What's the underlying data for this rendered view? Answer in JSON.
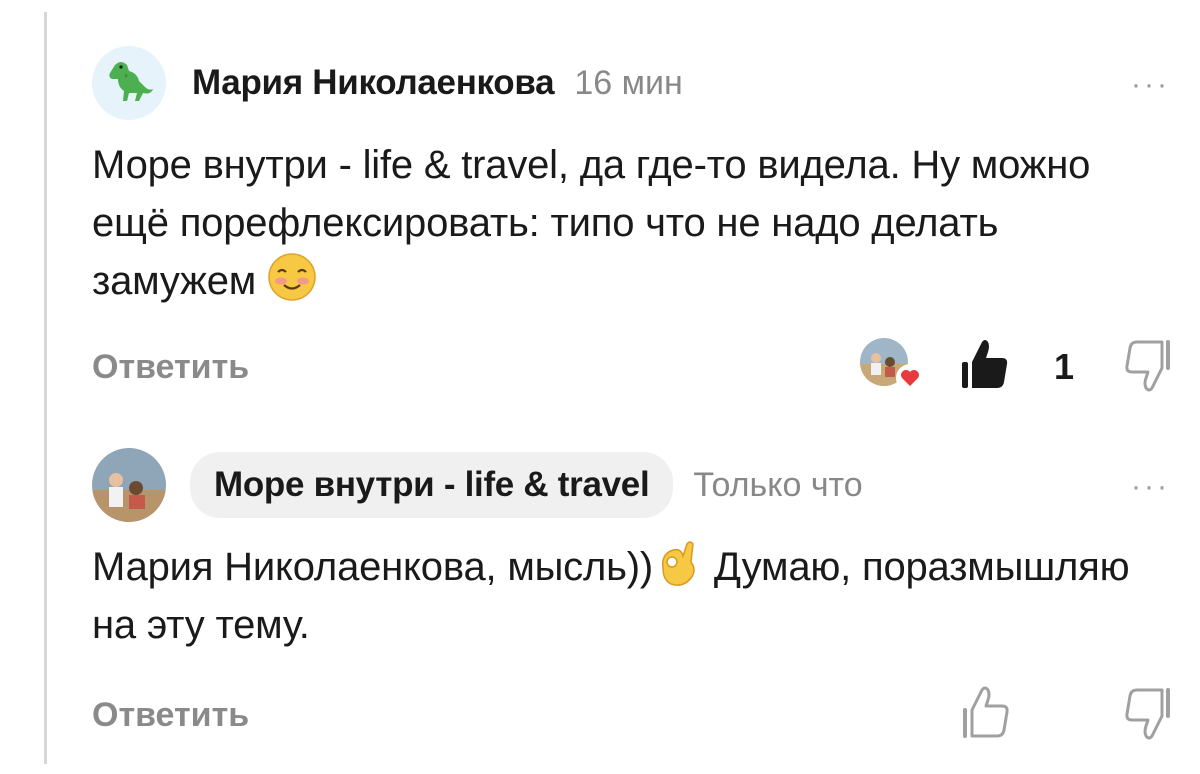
{
  "comments": [
    {
      "author": "Мария Николаенкова",
      "time": "16 мин",
      "text": "Море внутри - life & travel, да где-то видела. Ну можно ещё порефлексировать: типо что не надо делать замужем",
      "emoji": "smiling-blush-emoji",
      "reply_label": "Ответить",
      "like_count": "1",
      "liked": true,
      "more_label": "···"
    },
    {
      "author": "Море внутри - life & travel",
      "time": "Только что",
      "text_before": "Мария Николаенкова, мысль))",
      "emoji": "ok-hand-emoji",
      "text_after": " Думаю, поразмышляю на эту тему.",
      "reply_label": "Ответить",
      "liked": false,
      "more_label": "···"
    }
  ],
  "colors": {
    "accent_heart": "#e8393f",
    "muted": "#8a8a8a",
    "chip_bg": "#f0f0f0"
  }
}
